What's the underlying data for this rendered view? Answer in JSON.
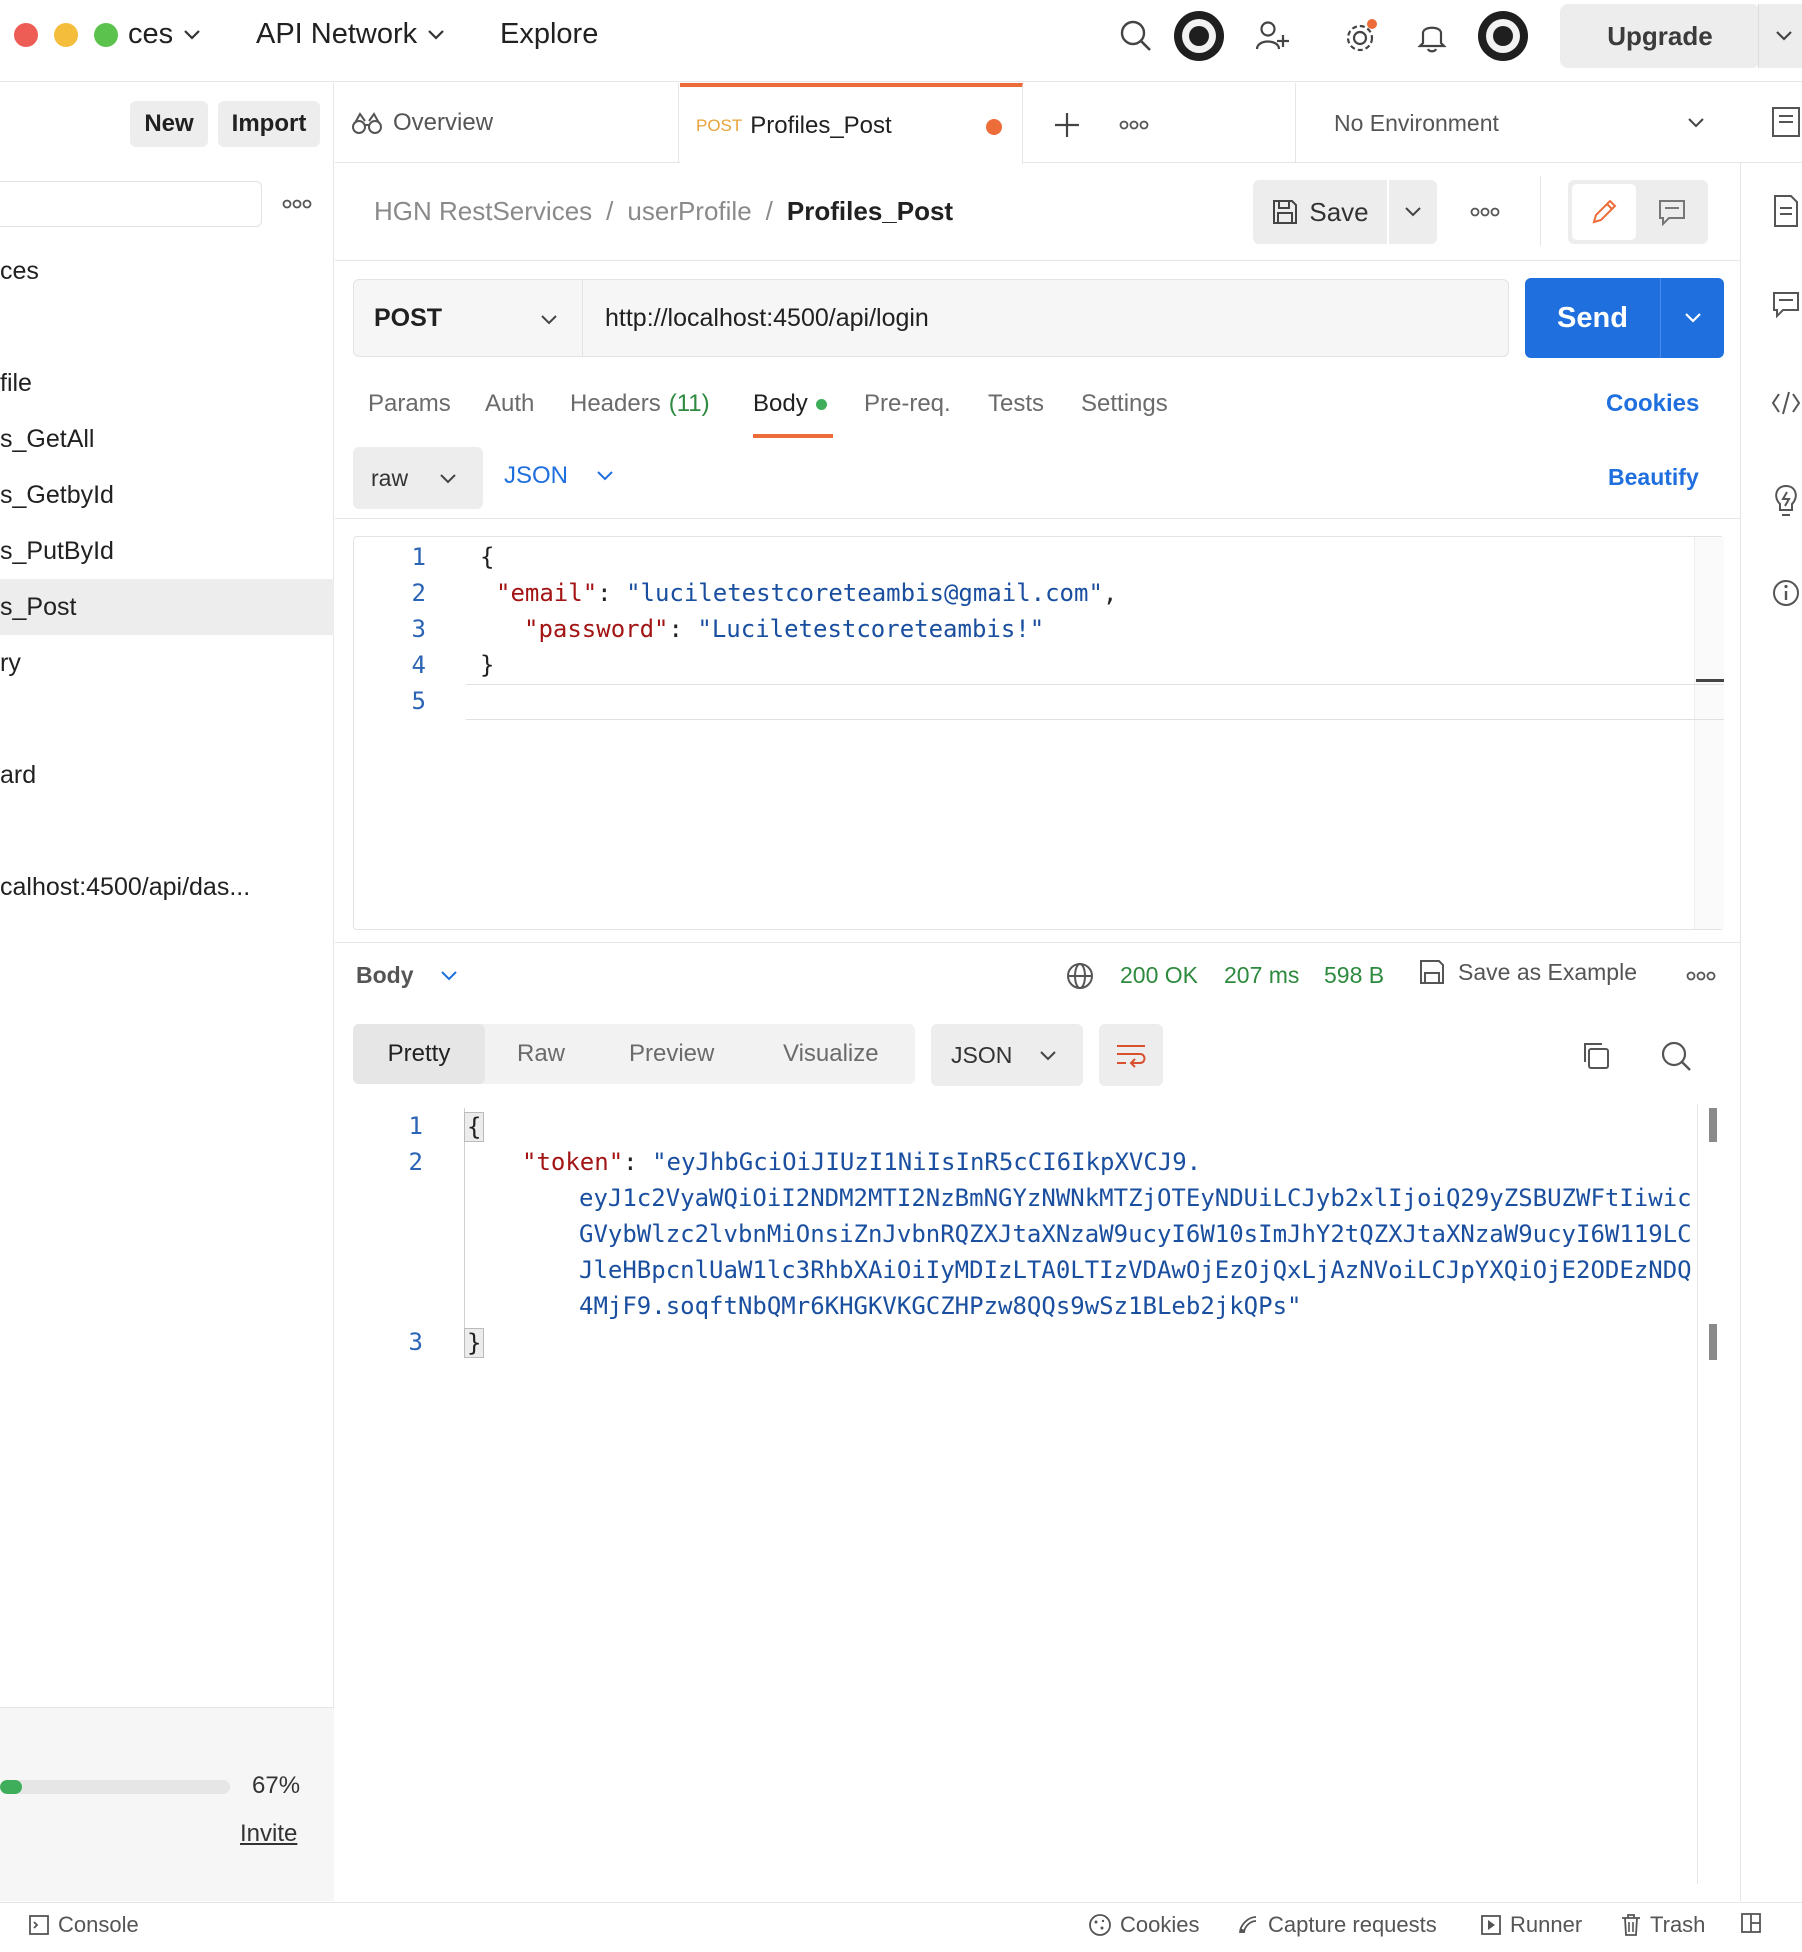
{
  "topbar": {
    "workspace": "ces",
    "api_network": "API Network",
    "explore": "Explore",
    "upgrade": "Upgrade"
  },
  "sidebar": {
    "new_label": "New",
    "import_label": "Import",
    "items": [
      "ces",
      "file",
      "s_GetAll",
      "s_GetbyId",
      "s_PutById",
      "s_Post",
      "ry",
      "ard",
      "calhost:4500/api/das..."
    ],
    "progress_percent": "67%",
    "progress_value": 0.67,
    "invite": "Invite"
  },
  "tabs": {
    "overview": "Overview",
    "active_method": "POST",
    "active_name": "Profiles_Post",
    "environment": "No Environment"
  },
  "breadcrumb": {
    "collection": "HGN RestServices",
    "folder": "userProfile",
    "request": "Profiles_Post",
    "save": "Save"
  },
  "request": {
    "method": "POST",
    "url": "http://localhost:4500/api/login",
    "send": "Send",
    "tabs": {
      "params": "Params",
      "auth": "Auth",
      "headers": "Headers",
      "headers_count": "(11)",
      "body": "Body",
      "prereq": "Pre-req.",
      "tests": "Tests",
      "settings": "Settings",
      "cookies": "Cookies"
    },
    "body_mode": "raw",
    "body_lang": "JSON",
    "beautify": "Beautify",
    "body_lines": {
      "l1": "{",
      "l2_key": "\"email\"",
      "l2_val": "\"luciletestcoreteambis@gmail.com\"",
      "l3_key": "\"password\"",
      "l3_val": "\"Luciletestcoreteambis!\"",
      "l4": "}"
    }
  },
  "response": {
    "label": "Body",
    "status": "200 OK",
    "time": "207 ms",
    "size": "598 B",
    "save_example": "Save as Example",
    "tabs": {
      "pretty": "Pretty",
      "raw": "Raw",
      "preview": "Preview",
      "visualize": "Visualize"
    },
    "lang": "JSON",
    "lines": {
      "open": "{",
      "key": "\"token\"",
      "v1": "\"eyJhbGciOiJIUzI1NiIsInR5cCI6IkpXVCJ9.",
      "v2": "eyJ1c2VyaWQiOiI2NDM2MTI2NzBmNGYzNWNkMTZjOTEyNDUiLCJyb2xlIjoiQ29yZSBUZWFtIiwic",
      "v3": "GVybWlzc2lvbnMiOnsiZnJvbnRQZXJtaXNzaW9ucyI6W10sImJhY2tQZXJtaXNzaW9ucyI6W119LC",
      "v4": "JleHBpcnlUaW1lc3RhbXAiOiIyMDIzLTA0LTIzVDAwOjEzOjQxLjAzNVoiLCJpYXQiOjE2ODEzNDQ",
      "v5": "4MjF9.soqftNbQMr6KHGKVKGCZHPzw8QQs9wSz1BLeb2jkQPs\"",
      "close": "}"
    }
  },
  "statusbar": {
    "console": "Console",
    "cookies": "Cookies",
    "capture": "Capture requests",
    "runner": "Runner",
    "trash": "Trash"
  },
  "colors": {
    "accent_blue": "#1f6fde",
    "post_orange": "#e8a33a",
    "tab_indicator": "#ec6c3a",
    "success_green": "#2e8a3e"
  }
}
